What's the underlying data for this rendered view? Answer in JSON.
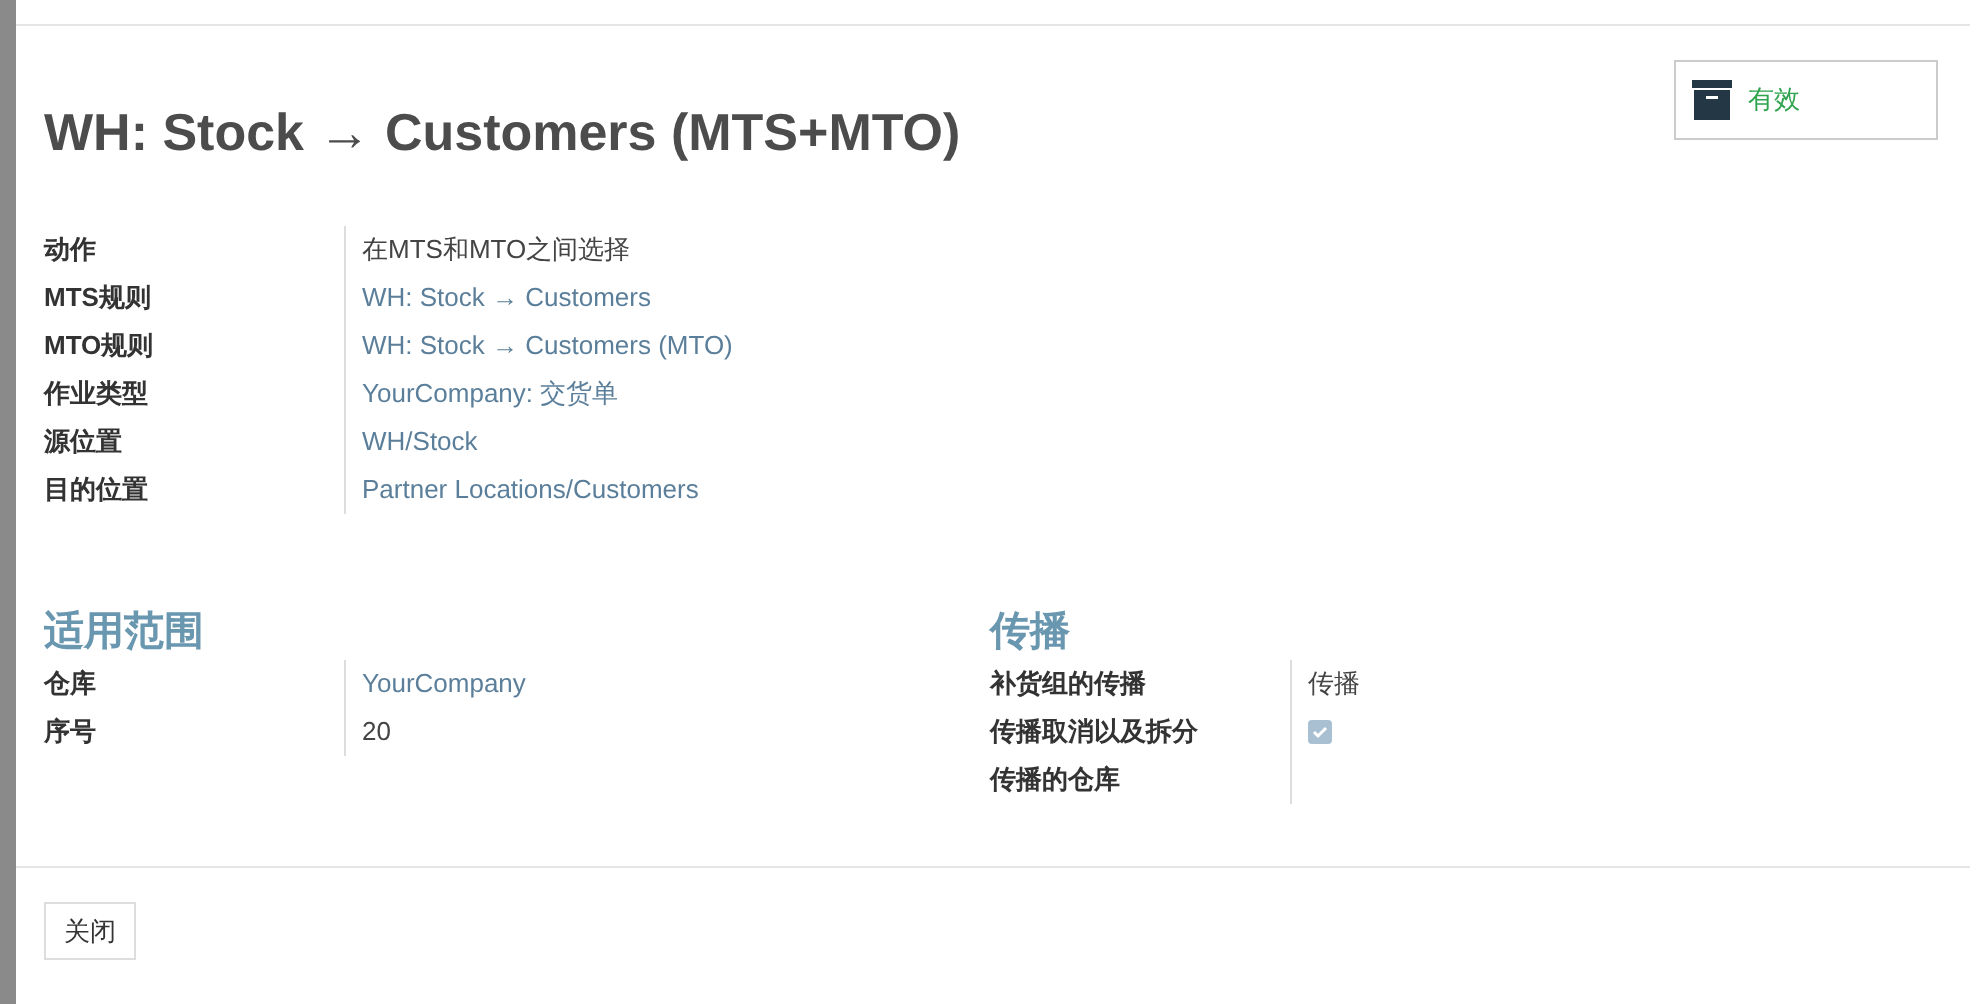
{
  "title": "WH: Stock → Customers (MTS+MTO)",
  "status_button": {
    "label": "有效",
    "active": true
  },
  "fields": [
    {
      "label": "动作",
      "value": "在MTS和MTO之间选择",
      "kind": "text"
    },
    {
      "label": "MTS规则",
      "value": "WH: Stock → Customers",
      "kind": "link"
    },
    {
      "label": "MTO规则",
      "value": "WH: Stock → Customers (MTO)",
      "kind": "link"
    },
    {
      "label": "作业类型",
      "value": "YourCompany: 交货单",
      "kind": "link"
    },
    {
      "label": "源位置",
      "value": "WH/Stock",
      "kind": "link"
    },
    {
      "label": "目的位置",
      "value": "Partner Locations/Customers",
      "kind": "link"
    }
  ],
  "sections": [
    {
      "heading": "适用范围",
      "fields": [
        {
          "label": "仓库",
          "value": "YourCompany",
          "kind": "link"
        },
        {
          "label": "序号",
          "value": "20",
          "kind": "text"
        }
      ]
    },
    {
      "heading": "传播",
      "fields": [
        {
          "label": "补货组的传播",
          "value": "传播",
          "kind": "text"
        },
        {
          "label": "传播取消以及拆分",
          "kind": "checkbox",
          "checked": true
        },
        {
          "label": "传播的仓库",
          "kind": "empty"
        }
      ]
    }
  ],
  "footer_buttons": [
    "关闭"
  ]
}
